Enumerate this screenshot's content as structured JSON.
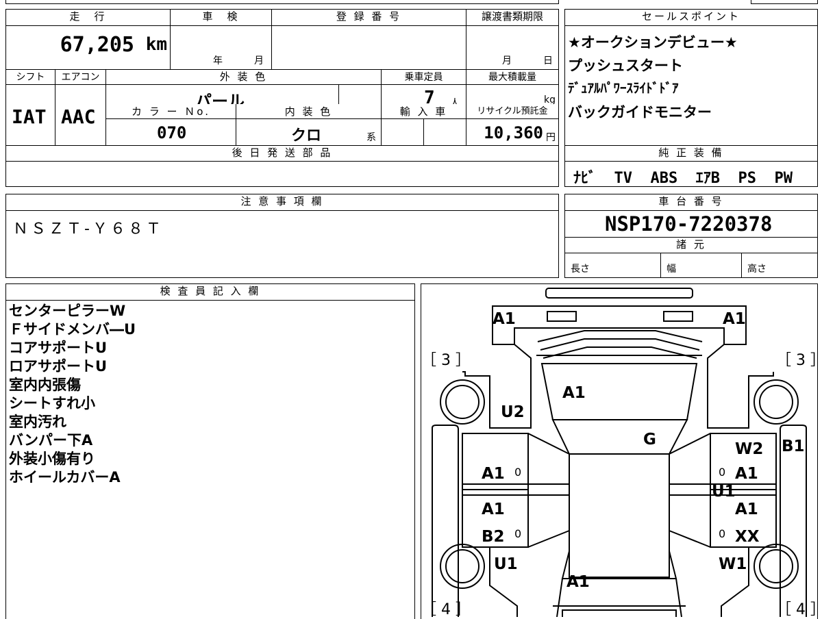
{
  "vehicle": {
    "mileage_label": "走　行",
    "mileage": "67,205",
    "mileage_unit": "km",
    "shaken_label": "車　検",
    "shaken_year": "年",
    "shaken_month": "月",
    "reg_label": "登 録 番 号",
    "transfer_label": "譲渡書類期限",
    "transfer_month": "月",
    "transfer_day": "日",
    "shift_label": "シフト",
    "shift": "IAT",
    "ac_label": "エアコン",
    "ac": "AAC",
    "exterior_label": "外 装 色",
    "exterior": "パール",
    "color_no_label": "カ ラ ー Ｎo.",
    "color_no": "070",
    "interior_label": "内 装 色",
    "interior": "クロ",
    "interior_suffix": "系",
    "capacity_label": "乗車定員",
    "capacity": "7",
    "capacity_unit": "人",
    "import_label": "輸 入 車",
    "load_label": "最大積載量",
    "load_unit": "kg",
    "recycle_label": "リサイクル預託金",
    "recycle": "10,360",
    "recycle_unit": "円",
    "parts_label": "後 日 発 送 部 品"
  },
  "sales_points": {
    "label": "セールスポイント",
    "items": [
      "★オークションデビュー★",
      "プッシュスタート",
      "ﾃﾞｭｱﾙﾊﾟﾜｰｽﾗｲﾄﾞﾄﾞｱ",
      "バックガイドモニター"
    ]
  },
  "equipment": {
    "label": "純 正 装 備",
    "items": [
      "ﾅﾋﾞ",
      "TV",
      "ABS",
      "ｴｱB",
      "PS",
      "PW"
    ]
  },
  "notes": {
    "label": "注 意 事 項 欄",
    "text": "ＮＳＺＴ-Ｙ６８Ｔ"
  },
  "chassis": {
    "label": "車 台 番 号",
    "number": "NSP170-7220378",
    "specs_label": "諸 元",
    "length_label": "長さ",
    "width_label": "幅",
    "height_label": "高さ"
  },
  "inspector": {
    "label": "検 査 員 記 入 欄",
    "lines": [
      "センターピラーW",
      "Ｆサイドメンバ―U",
      "コアサポートU",
      "ロアサポートU",
      "室内内張傷",
      "シートすれ小",
      "室内汚れ",
      "バンパー下A",
      "外装小傷有り",
      "ホイールカバーA"
    ]
  },
  "diagram": {
    "marks": {
      "front_left": "A1",
      "front_right": "A1",
      "tire_fl": "［ 3 ］",
      "tire_fr": "［ 3 ］",
      "tire_rl": "［ 4 ］",
      "tire_rr": "［ 4 ］",
      "bonnet": "A1",
      "fender_left": "U2",
      "windshield": "G",
      "roof_right_w": "W2",
      "right_b1": "B1",
      "left_door_front": "A1",
      "right_door_front": "A1",
      "right_u1_center": "U1",
      "left_door_rear": "A1",
      "right_door_rear": "A1",
      "left_b2": "B2",
      "right_xx": "XX",
      "left_quarter": "U1",
      "right_quarter": "W1",
      "rear": "A1",
      "zero_l1": "0",
      "zero_r1": "0",
      "zero_l2": "0",
      "zero_r2": "0"
    }
  }
}
